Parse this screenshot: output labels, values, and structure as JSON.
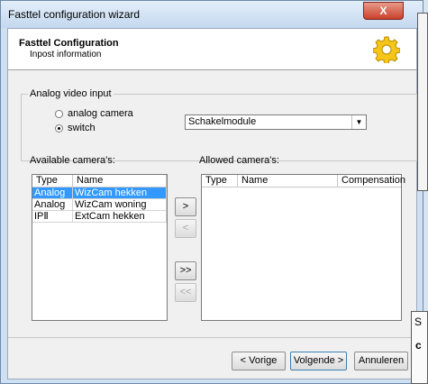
{
  "window": {
    "title": "Fasttel configuration wizard",
    "close_label": "X"
  },
  "header": {
    "title": "Fasttel Configuration",
    "subtitle": "Inpost information",
    "icon": "gear-icon"
  },
  "video_input": {
    "group_label": "Analog video input",
    "options": [
      {
        "label": "analog camera",
        "selected": false
      },
      {
        "label": "switch",
        "selected": true
      }
    ],
    "select_value": "Schakelmodule"
  },
  "available": {
    "label": "Available camera's:",
    "columns": [
      "Type",
      "Name"
    ],
    "rows": [
      {
        "type": "Analog",
        "name": "WizCam hekken",
        "selected": true
      },
      {
        "type": "Analog",
        "name": "WizCam woning",
        "selected": false
      },
      {
        "type": "IPⅡ",
        "name": "ExtCam hekken",
        "selected": false
      }
    ]
  },
  "allowed": {
    "label": "Allowed camera's:",
    "columns": [
      "Type",
      "Name",
      "Compensation"
    ]
  },
  "transfer_buttons": {
    "add": ">",
    "remove": "<",
    "add_all": ">>",
    "remove_all": "<<"
  },
  "footer": {
    "back_label": "< Vorige",
    "next_label": "Volgende >",
    "cancel_label": "Annuleren"
  },
  "overlay_text": {
    "line1": "S",
    "line2": "c"
  }
}
